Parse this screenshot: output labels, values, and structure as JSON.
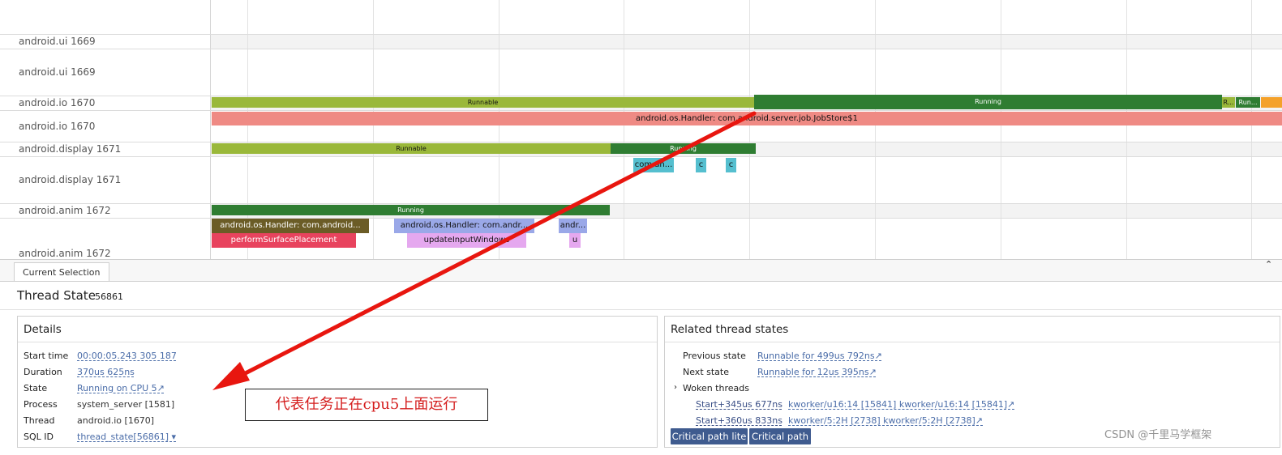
{
  "tracks": [
    {
      "label": "android.ui 1669"
    },
    {
      "label": "android.ui 1669"
    },
    {
      "label": "android.io 1670"
    },
    {
      "label": "android.io 1670"
    },
    {
      "label": "android.display 1671"
    },
    {
      "label": "android.display 1671"
    },
    {
      "label": "android.anim 1672"
    },
    {
      "label": "android.anim 1672"
    }
  ],
  "slices": {
    "io_runnable": "Runnable",
    "io_running": "Running",
    "io_r_short": "R...",
    "io_run_short": "Run...",
    "io_handler": "android.os.Handler: com.android.server.job.JobStore$1",
    "display_runnable": "Runnable",
    "display_running": "Running",
    "display_com": "com.an...",
    "display_c1": "c",
    "display_c2": "c",
    "anim_running": "Running",
    "anim_handler1": "android.os.Handler: com.android...",
    "anim_handler2": "android.os.Handler: com.andr...",
    "anim_handler3": "andr...",
    "anim_perform": "performSurfacePlacement",
    "anim_update": "updateInputWindows",
    "anim_u": "u"
  },
  "colors": {
    "runnable": "#9ab83a",
    "running": "#2f7d32",
    "handler_io": "#ef8a84",
    "orange": "#f4a12a",
    "teal": "#55bfcf",
    "olive": "#6b5c26",
    "lavender": "#9aa8e8",
    "pink_red": "#e8435e",
    "light_pink": "#e5a8ef",
    "button": "#3f5b8f",
    "annotation_red": "#e8160f"
  },
  "panel": {
    "tab_label": "Current Selection",
    "title": "Thread State",
    "id": "56861"
  },
  "details": {
    "title": "Details",
    "rows": [
      {
        "key": "Start time",
        "value": "00:00:05.243 305 187"
      },
      {
        "key": "Duration",
        "value": "370us 625ns"
      },
      {
        "key": "State",
        "value": "Running on CPU 5↗"
      },
      {
        "key": "Process",
        "value": "system_server [1581]"
      },
      {
        "key": "Thread",
        "value": "android.io [1670]"
      },
      {
        "key": "SQL ID",
        "value": "thread_state[56861] ▾"
      }
    ]
  },
  "related": {
    "title": "Related thread states",
    "previous_key": "Previous state",
    "previous_val": "Runnable for 499us 792ns↗",
    "next_key": "Next state",
    "next_val": "Runnable for 12us 395ns↗",
    "woken_label": "Woken threads",
    "woken": [
      {
        "time": "Start+345us 677ns",
        "thread": "kworker/u16:14 [15841] kworker/u16:14 [15841]↗"
      },
      {
        "time": "Start+360us 833ns",
        "thread": "kworker/5:2H [2738] kworker/5:2H [2738]↗"
      }
    ],
    "btn_critical_lite": "Critical path lite",
    "btn_critical": "Critical path"
  },
  "annotation": "代表任务正在cpu5上面运行",
  "watermark": "CSDN @千里马学框架"
}
